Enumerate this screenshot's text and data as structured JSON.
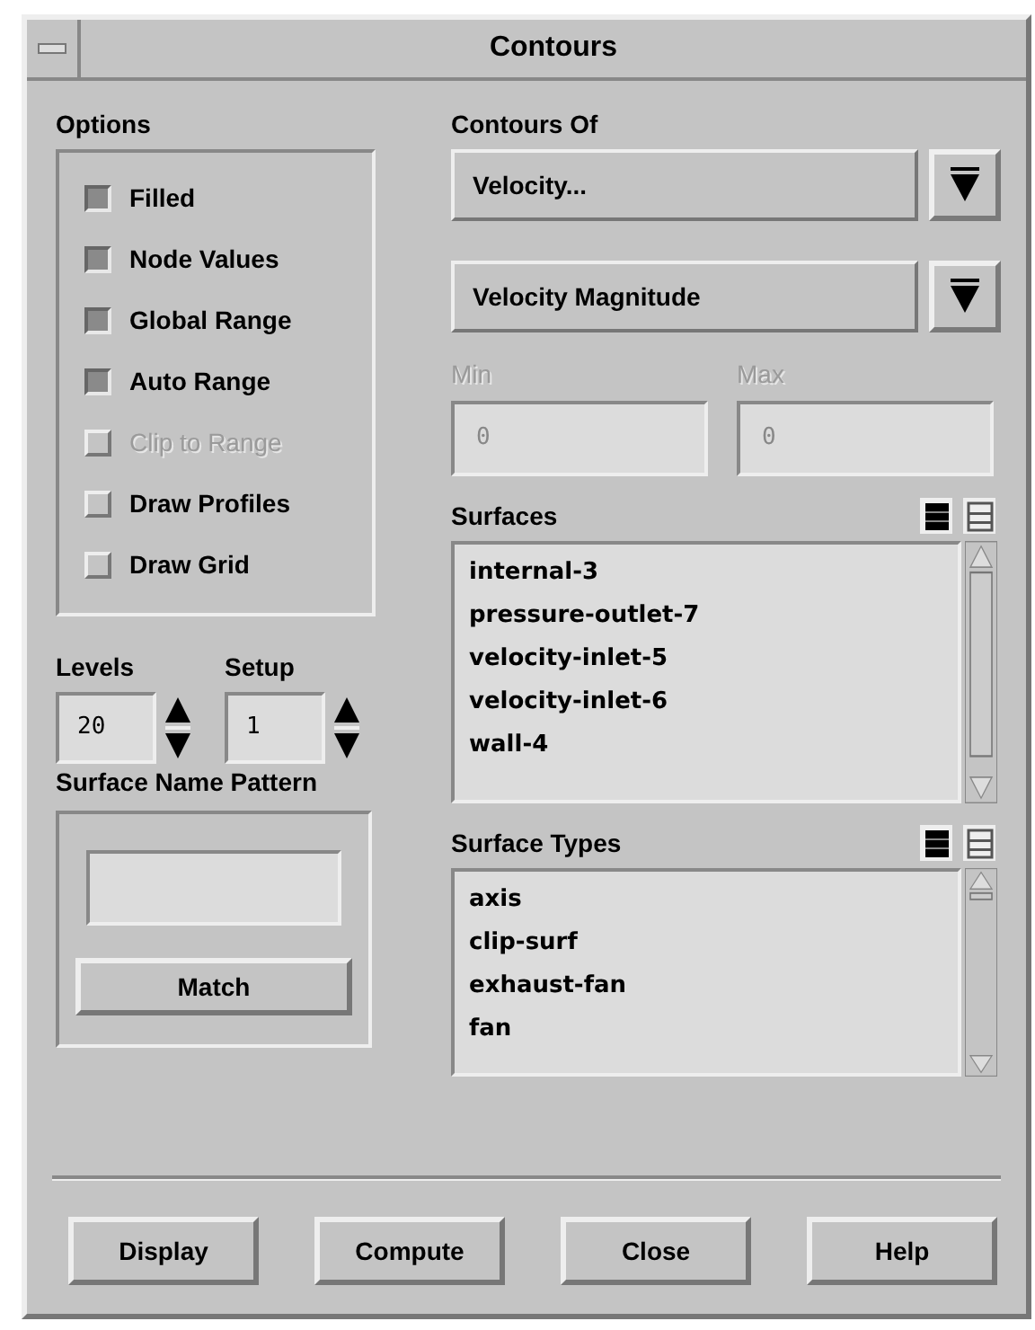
{
  "window": {
    "title": "Contours"
  },
  "options": {
    "label": "Options",
    "items": [
      {
        "label": "Filled",
        "checked": true,
        "disabled": false
      },
      {
        "label": "Node Values",
        "checked": true,
        "disabled": false
      },
      {
        "label": "Global Range",
        "checked": true,
        "disabled": false
      },
      {
        "label": "Auto Range",
        "checked": true,
        "disabled": false
      },
      {
        "label": "Clip to Range",
        "checked": false,
        "disabled": true
      },
      {
        "label": "Draw Profiles",
        "checked": false,
        "disabled": false
      },
      {
        "label": "Draw Grid",
        "checked": false,
        "disabled": false
      }
    ]
  },
  "spinners": [
    {
      "label": "Levels",
      "value": "20"
    },
    {
      "label": "Setup",
      "value": "1"
    }
  ],
  "surface_name_pattern": {
    "label": "Surface Name Pattern",
    "button": "Match"
  },
  "contours_of": {
    "label": "Contours Of",
    "dropdowns": [
      {
        "value": "Velocity..."
      },
      {
        "value": "Velocity Magnitude"
      }
    ]
  },
  "range": [
    {
      "label": "Min",
      "value": "0",
      "disabled": true
    },
    {
      "label": "Max",
      "value": "0",
      "disabled": true
    }
  ],
  "surfaces": {
    "label": "Surfaces",
    "items": [
      "internal-3",
      "pressure-outlet-7",
      "velocity-inlet-5",
      "velocity-inlet-6",
      "wall-4"
    ]
  },
  "surface_types": {
    "label": "Surface Types",
    "items": [
      "axis",
      "clip-surf",
      "exhaust-fan",
      "fan"
    ]
  },
  "buttons": [
    "Display",
    "Compute",
    "Close",
    "Help"
  ]
}
